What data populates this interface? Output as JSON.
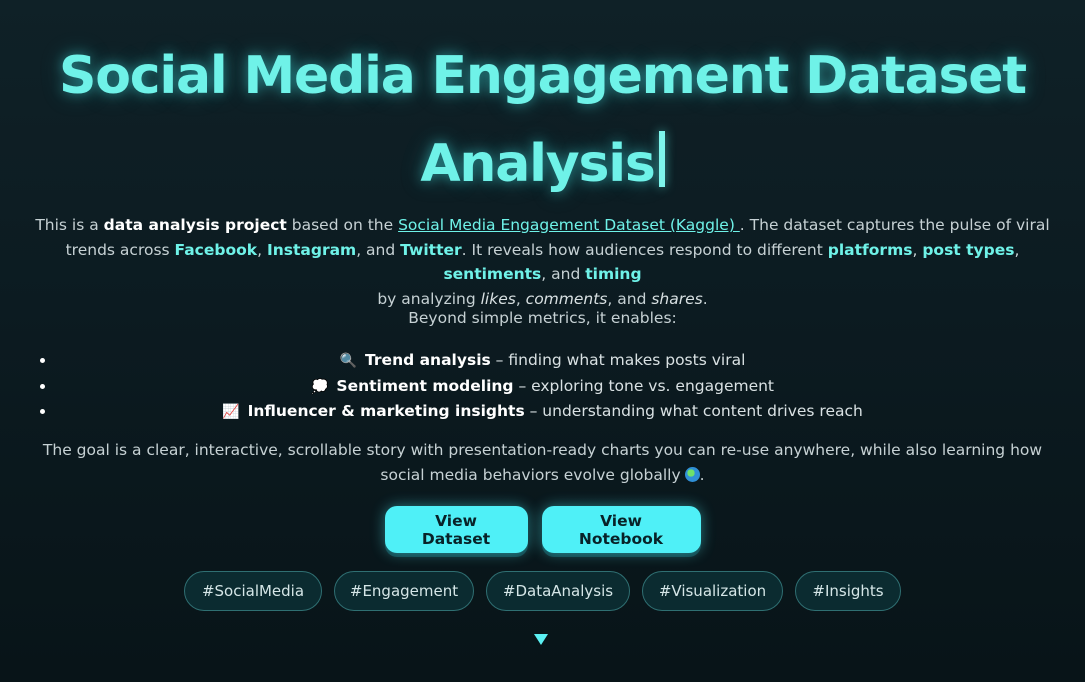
{
  "hero": {
    "title": "Social Media Engagement Dataset Analysis",
    "intro": {
      "p1": "This is a ",
      "project": "data analysis project",
      "p2": " based on the ",
      "link": "Social Media Engagement Dataset (Kaggle) ",
      "p3": ". The dataset captures the pulse of viral trends across ",
      "facebook": "Facebook",
      "sep1": ", ",
      "instagram": "Instagram",
      "sep2": ", and ",
      "twitter": "Twitter",
      "p4": ". It reveals how audiences respond to different ",
      "platforms": "platforms",
      "sep3": ", ",
      "post_types": "post types",
      "sep4": ", ",
      "sentiments": "sentiments",
      "sep5": ", and ",
      "timing": "timing",
      "p5": " by analyzing ",
      "likes": "likes",
      "sep6": ", ",
      "comments": "comments",
      "sep7": ", and ",
      "shares": "shares",
      "p6": "."
    },
    "beyond": "Beyond simple metrics, it enables:",
    "features": [
      {
        "icon": "🔍",
        "title": "Trend analysis",
        "text": " – finding what makes posts viral"
      },
      {
        "icon": "💭",
        "title": "Sentiment modeling",
        "text": " – exploring tone vs. engagement"
      },
      {
        "icon": "📈",
        "title": "Influencer & marketing insights",
        "text": " – understanding what content drives reach"
      }
    ],
    "goal": "The goal is a clear, interactive, scrollable story with presentation-ready charts you can re-use anywhere, while also learning how social media behaviors evolve globally",
    "goal_end": ".",
    "buttons": {
      "dataset": "View Dataset",
      "notebook": "View Notebook"
    },
    "tags": [
      "#SocialMedia",
      "#Engagement",
      "#DataAnalysis",
      "#Visualization",
      "#Insights"
    ],
    "icons": {
      "globe": "globe-icon",
      "scroll": "chevron-down-icon"
    },
    "colors": {
      "accent": "#6ff2e8",
      "button": "#4ff0f7",
      "background": "#0c1b21"
    }
  }
}
